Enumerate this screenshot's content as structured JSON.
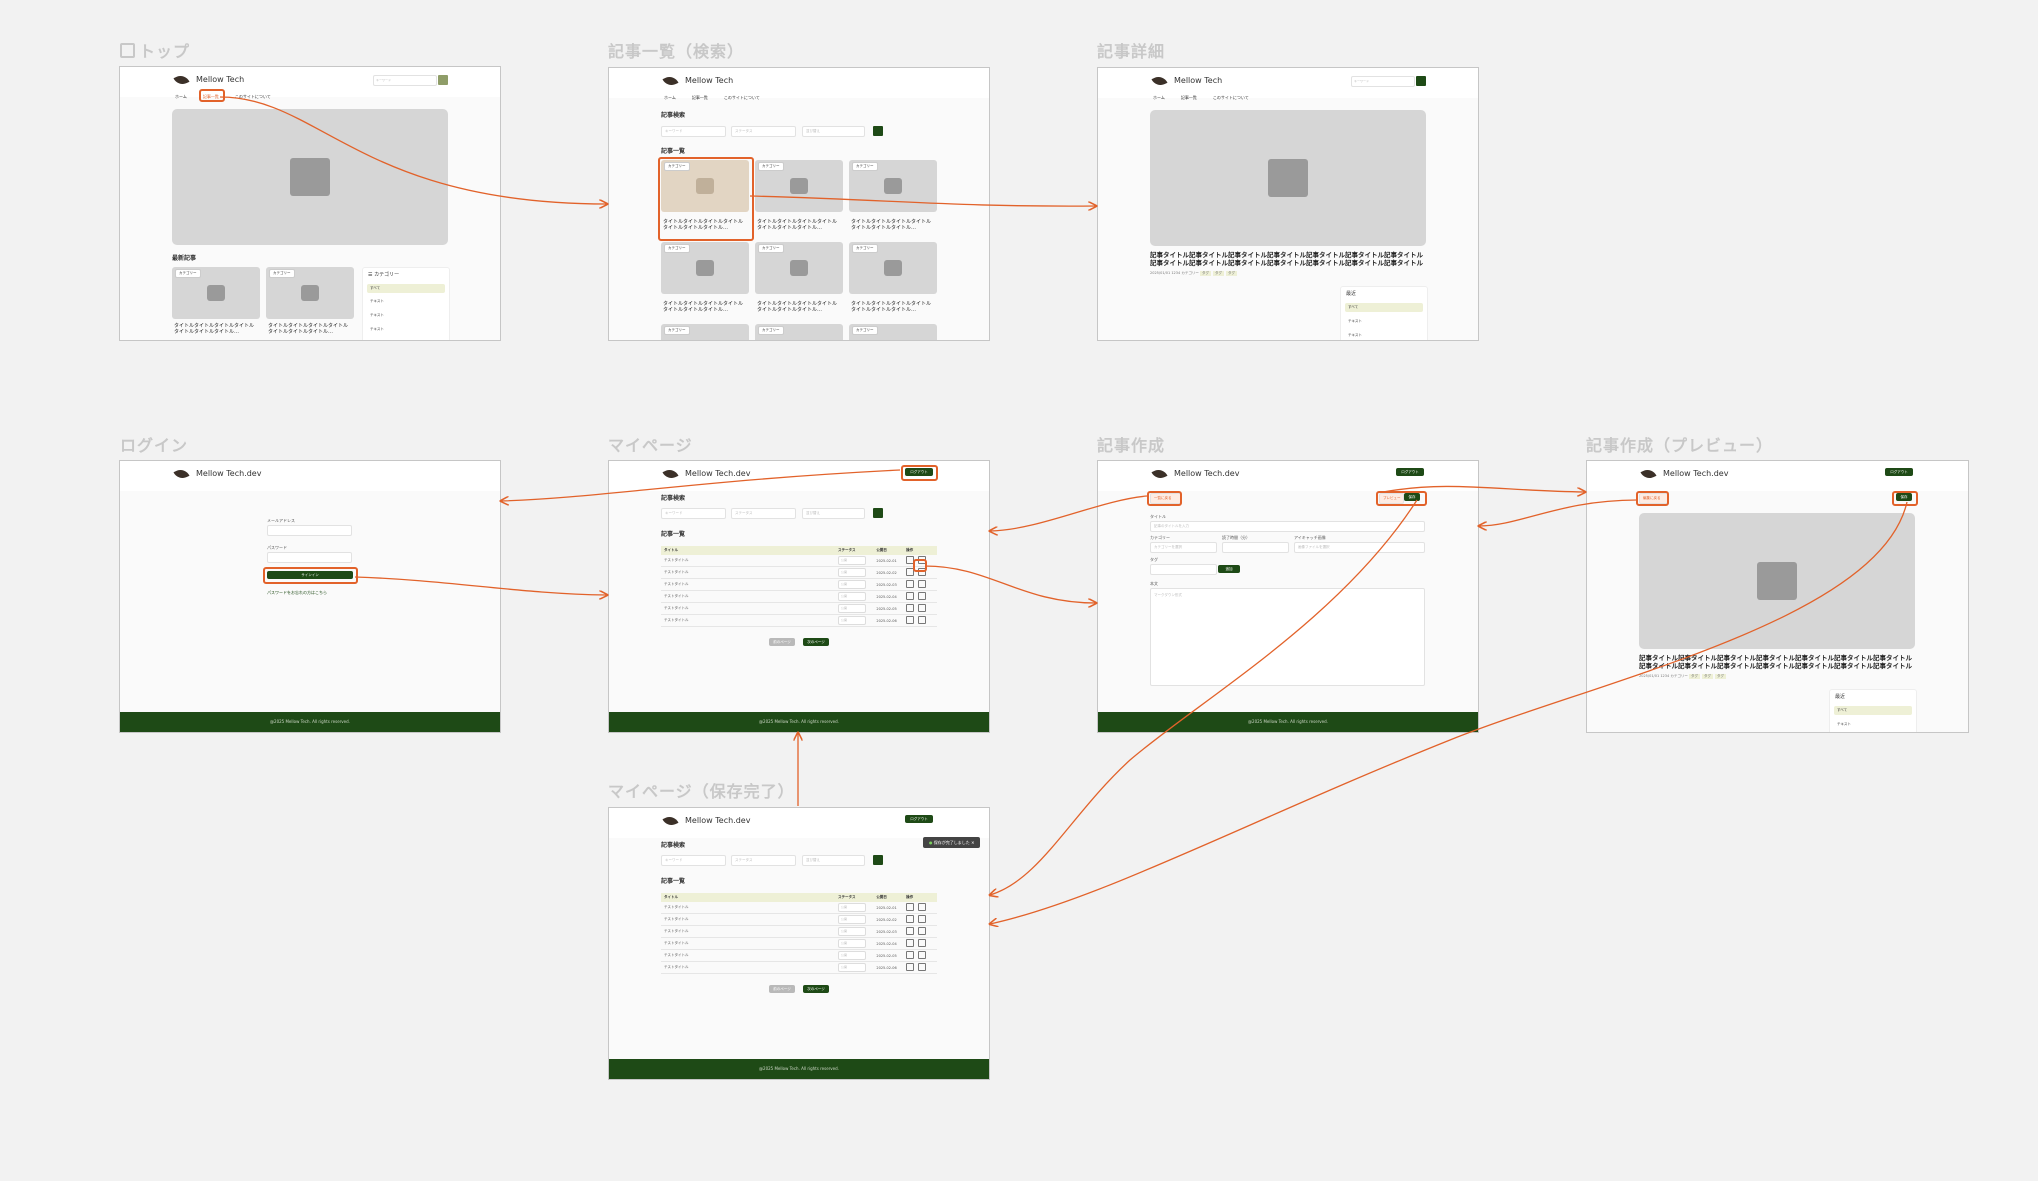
{
  "labels": {
    "top": "トップ",
    "list": "記事一覧（検索）",
    "detail": "記事詳細",
    "login": "ログイン",
    "mypage": "マイページ",
    "create": "記事作成",
    "preview": "記事作成（プレビュー）",
    "saved": "マイページ（保存完了）"
  },
  "brand": "Mellow Tech",
  "brand_dev": "Mellow Tech.dev",
  "search_placeholder": "キーワード",
  "nav": {
    "home": "ホーム",
    "list": "記事一覧",
    "about": "このサイトについて"
  },
  "logout": "ログアウト",
  "category_tag": "カテゴリー",
  "card_title": "タイトルタイトルタイトルタイトルタイトルタイトルタイトル…",
  "sections": {
    "latest": "最新記事",
    "search": "記事検索",
    "list": "記事一覧",
    "category": "カテゴリー",
    "tags": "最近"
  },
  "filters": {
    "keyword": "キーワード",
    "status": "ステータス",
    "sort": "並び替え"
  },
  "article_title": "記事タイトル記事タイトル記事タイトル記事タイトル記事タイトル記事タイトル記事タイトル記事タイトル記事タイトル記事タイトル記事タイトル記事タイトル記事タイトル記事タイトル記…",
  "meta": {
    "date": "2025/01/01",
    "views": "1234",
    "cat": "カテゴリー",
    "tag1": "タグ",
    "tag2": "タグ",
    "tag3": "タグ"
  },
  "sidebar": {
    "all": "すべて",
    "item1": "テキスト",
    "item2": "テキスト",
    "item3": "テキスト"
  },
  "login": {
    "email": "メールアドレス",
    "password": "パスワード",
    "signin": "サインイン",
    "forgot": "パスワードをお忘れの方はこちら"
  },
  "table": {
    "headers": [
      "タイトル",
      "ステータス",
      "公開日",
      "操作"
    ],
    "row_title": "テストタイトル",
    "row_status": "公開",
    "row_dates": [
      "2025-02-01",
      "2025-02-02",
      "2025-02-03",
      "2025-02-04",
      "2025-02-05",
      "2025-02-06"
    ]
  },
  "paging": {
    "prev": "前のページ",
    "next": "次のページ"
  },
  "create": {
    "back": "一覧に戻る",
    "preview": "プレビュー",
    "save": "保存",
    "title": "タイトル",
    "title_ph": "記事のタイトルを入力",
    "category": "カテゴリー",
    "category_ph": "カテゴリーを選択",
    "reading": "読了時間（分）",
    "eyecatch": "アイキャッチ画像",
    "eyecatch_ph": "画像ファイルを選択",
    "tags": "タグ",
    "add": "追加",
    "body": "本文",
    "body_ph": "マークダウン形式"
  },
  "preview": {
    "back": "編集に戻る",
    "save": "保存"
  },
  "toast": "保存が完了しました",
  "footer": "@2025 Mellow Tech. All rights reserved."
}
